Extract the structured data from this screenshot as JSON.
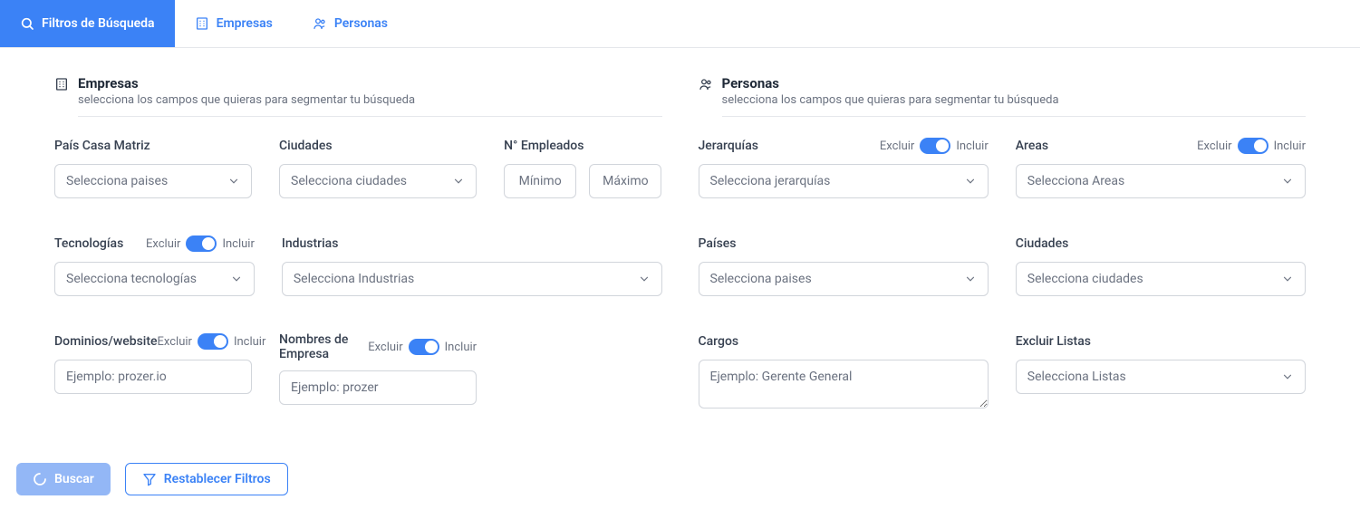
{
  "tabs": {
    "filtros": "Filtros de Búsqueda",
    "empresas": "Empresas",
    "personas": "Personas"
  },
  "sections": {
    "empresas": {
      "title": "Empresas",
      "subtitle": "selecciona los campos que quieras para segmentar tu búsqueda"
    },
    "personas": {
      "title": "Personas",
      "subtitle": "selecciona los campos que quieras para segmentar tu búsqueda"
    }
  },
  "labels": {
    "pais_casa_matriz": "País Casa Matriz",
    "ciudades": "Ciudades",
    "n_empleados": "N° Empleados",
    "tecnologias": "Tecnologías",
    "industrias": "Industrias",
    "dominios": "Dominios/website",
    "nombres_empresa": "Nombres de Empresa",
    "jerarquias": "Jerarquías",
    "areas": "Areas",
    "paises": "Países",
    "ciudades_p": "Ciudades",
    "cargos": "Cargos",
    "excluir_listas": "Excluir Listas"
  },
  "placeholders": {
    "selecciona_paises": "Selecciona paises",
    "selecciona_ciudades": "Selecciona ciudades",
    "minimo": "Mínimo",
    "maximo": "Máximo",
    "selecciona_tecnologias": "Selecciona tecnologías",
    "selecciona_industrias": "Selecciona Industrias",
    "ejemplo_prozer_io": "Ejemplo: prozer.io",
    "ejemplo_prozer": "Ejemplo: prozer",
    "selecciona_jerarquias": "Selecciona jerarquías",
    "selecciona_areas": "Selecciona Areas",
    "ejemplo_gerente": "Ejemplo: Gerente General",
    "selecciona_listas": "Selecciona Listas"
  },
  "toggle": {
    "excluir": "Excluir",
    "incluir": "Incluir"
  },
  "buttons": {
    "buscar": "Buscar",
    "restablecer": "Restablecer Filtros"
  }
}
